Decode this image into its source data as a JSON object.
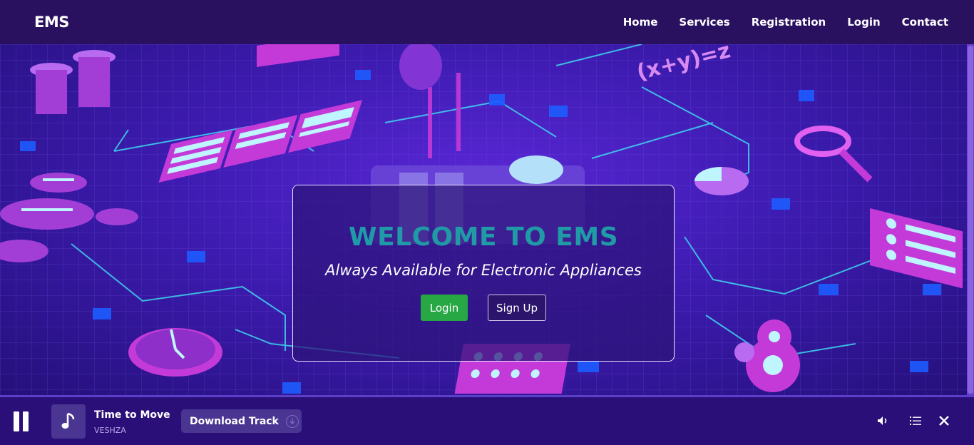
{
  "navbar": {
    "brand": "EMS",
    "links": [
      "Home",
      "Services",
      "Registration",
      "Login",
      "Contact"
    ]
  },
  "hero": {
    "title": "WELCOME TO EMS",
    "subtitle": "Always Available for Electronic Appliances",
    "login_label": "Login",
    "signup_label": "Sign Up"
  },
  "player": {
    "track_title": "Time to Move",
    "artist": "VESHZA",
    "download_label": "Download Track",
    "icons": [
      "pause-icon",
      "music-note-icon",
      "download-icon",
      "volume-icon",
      "playlist-icon",
      "close-icon"
    ]
  },
  "colors": {
    "navbar_bg": "#2a1160",
    "title": "#1f9aa6",
    "login_button": "#28a745",
    "player_bg": "#2b0f78"
  }
}
